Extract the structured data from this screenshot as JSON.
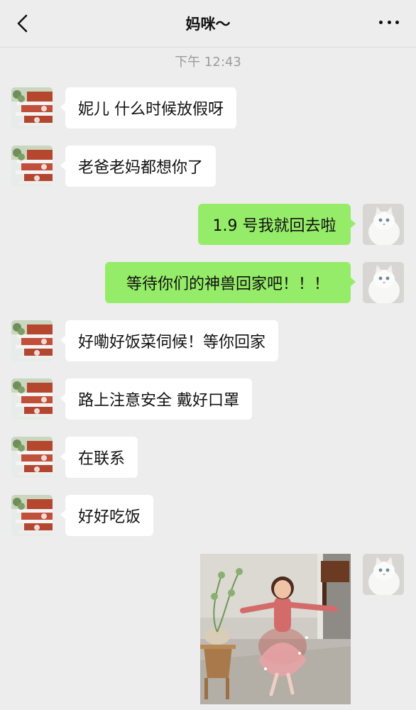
{
  "header": {
    "title": "妈咪～"
  },
  "timestamp": "下午 12:43",
  "messages": [
    {
      "side": "in",
      "text": "妮儿 什么时候放假呀"
    },
    {
      "side": "in",
      "text": "老爸老妈都想你了"
    },
    {
      "side": "out",
      "text": "1.9 号我就回去啦"
    },
    {
      "side": "out",
      "text": "等待你们的神兽回家吧！！！"
    },
    {
      "side": "in",
      "text": "好嘞好饭菜伺候！等你回家"
    },
    {
      "side": "in",
      "text": "路上注意安全 戴好口罩"
    },
    {
      "side": "in",
      "text": "在联系"
    },
    {
      "side": "in",
      "text": "好好吃饭"
    },
    {
      "side": "out",
      "type": "image",
      "description": "video-thumbnail"
    }
  ],
  "icons": {
    "back": "chevron-left-icon",
    "more": "more-dots-icon"
  },
  "colors": {
    "background": "#ededed",
    "outgoing_bubble": "#95ec69",
    "incoming_bubble": "#ffffff"
  }
}
